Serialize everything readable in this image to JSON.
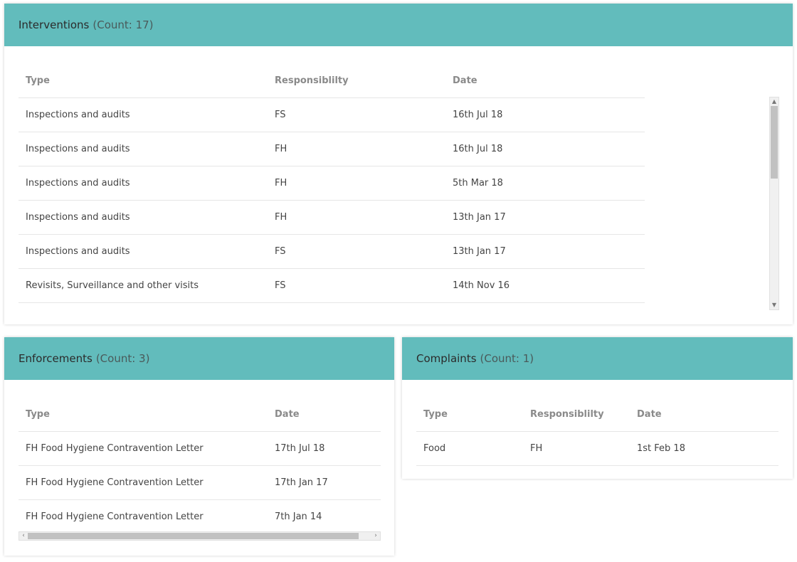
{
  "interventions": {
    "title": "Interventions",
    "count": "(Count: 17)",
    "columns": [
      "Type",
      "Responsiblilty",
      "Date"
    ],
    "rows": [
      [
        "Inspections and audits",
        "FS",
        "16th Jul 18"
      ],
      [
        "Inspections and audits",
        "FH",
        "16th Jul 18"
      ],
      [
        "Inspections and audits",
        "FH",
        "5th Mar 18"
      ],
      [
        "Inspections and audits",
        "FH",
        "13th Jan 17"
      ],
      [
        "Inspections and audits",
        "FS",
        "13th Jan 17"
      ],
      [
        "Revisits, Surveillance and other visits",
        "FS",
        "14th Nov 16"
      ]
    ]
  },
  "enforcements": {
    "title": "Enforcements",
    "count": "(Count: 3)",
    "columns": [
      "Type",
      "Date"
    ],
    "rows": [
      [
        "FH Food Hygiene Contravention Letter",
        "17th Jul 18"
      ],
      [
        "FH Food Hygiene Contravention Letter",
        "17th Jan 17"
      ],
      [
        "FH Food Hygiene Contravention Letter",
        "7th Jan 14"
      ]
    ]
  },
  "complaints": {
    "title": "Complaints",
    "count": "(Count: 1)",
    "columns": [
      "Type",
      "Responsiblilty",
      "Date"
    ],
    "rows": [
      [
        "Food",
        "FH",
        "1st Feb 18"
      ]
    ]
  },
  "colors": {
    "header_bg": "#62bcbc",
    "row_border": "#e6e6e6",
    "column_header_text": "#8a8a8a"
  },
  "icons": {
    "scroll_up": "scroll-up-icon",
    "scroll_down": "scroll-down-icon",
    "scroll_left": "scroll-left-icon",
    "scroll_right": "scroll-right-icon"
  }
}
